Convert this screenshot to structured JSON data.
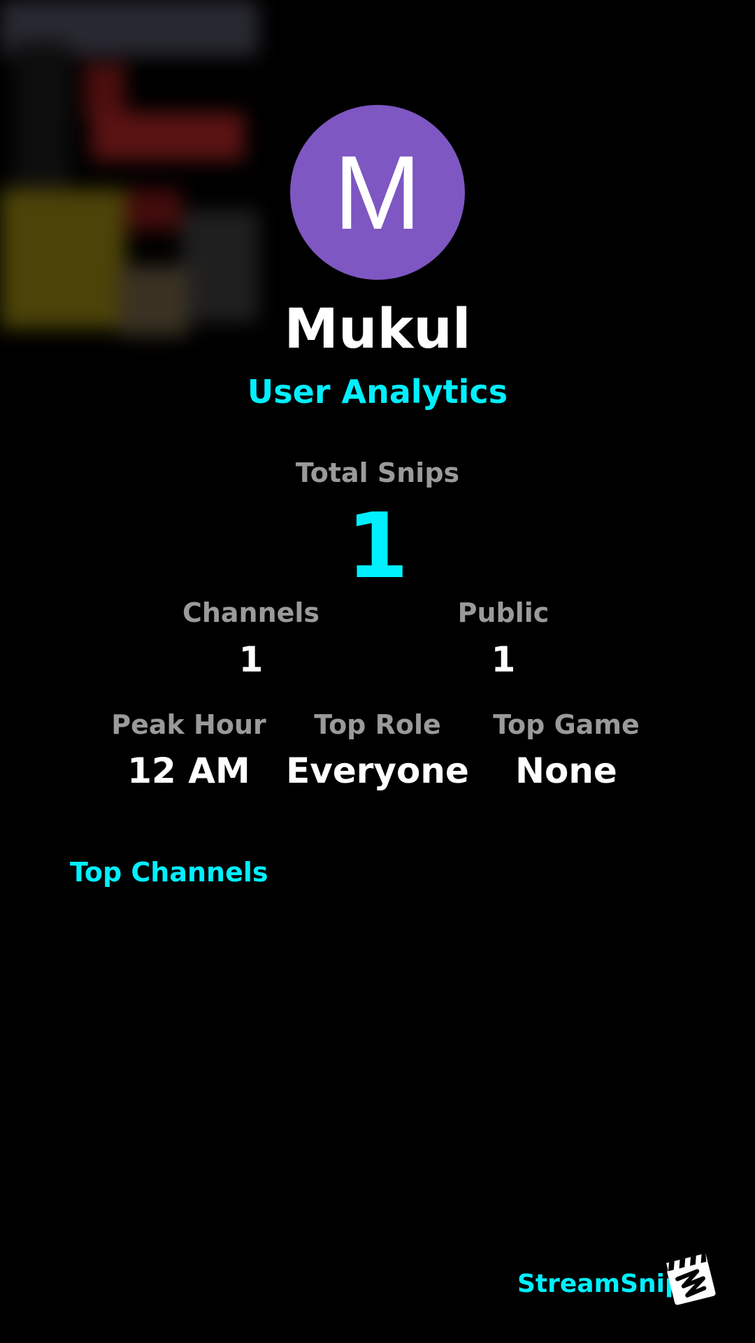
{
  "profile": {
    "initial": "M",
    "username": "Mukul",
    "subtitle": "User Analytics"
  },
  "stats": {
    "total_snips": {
      "label": "Total Snips",
      "value": "1"
    },
    "channels": {
      "label": "Channels",
      "value": "1"
    },
    "public": {
      "label": "Public",
      "value": "1"
    },
    "peak_hour": {
      "label": "Peak Hour",
      "value": "12 AM"
    },
    "top_role": {
      "label": "Top Role",
      "value": "Everyone"
    },
    "top_game": {
      "label": "Top Game",
      "value": "None"
    }
  },
  "top_channels": {
    "title": "Top Channels",
    "items": []
  },
  "brand": {
    "name": "StreamSnip",
    "logo_icon": "clapperboard-icon"
  },
  "colors": {
    "accent": "#00f0ff",
    "avatar_bg": "#7e57c2",
    "label_gray": "#9a9a9a",
    "background": "#000000"
  }
}
